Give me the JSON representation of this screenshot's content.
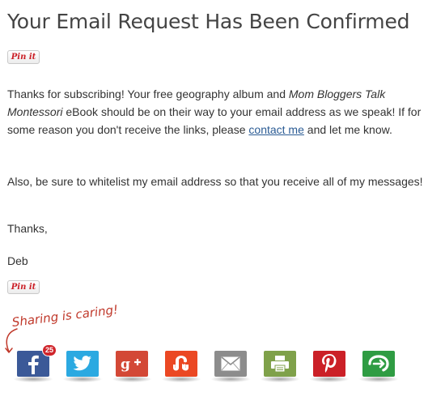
{
  "header": {
    "title": "Your Email Request Has Been Confirmed"
  },
  "pin_button": {
    "label": "Pin it"
  },
  "content": {
    "p1_before": "Thanks for subscribing! Your free geography album and ",
    "p1_italic": "Mom Bloggers Talk Montessori",
    "p1_middle": " eBook should be on their way to your email address as we speak! If for some reason you don't receive the links, please ",
    "p1_link": "contact me",
    "p1_after": " and let me know.",
    "p2": "Also, be sure to whitelist my email address so that you receive all of my messages!",
    "p3": "Thanks,",
    "p4": "Deb"
  },
  "sharing": {
    "caption": "Sharing is caring!",
    "caption_color": "#c0392b",
    "buttons": [
      {
        "icon": "facebook-icon",
        "color": "#3b5998",
        "badge": "25"
      },
      {
        "icon": "twitter-icon",
        "color": "#2ba9e1"
      },
      {
        "icon": "google-plus-icon",
        "color": "#d34836"
      },
      {
        "icon": "stumbleupon-icon",
        "color": "#eb4823"
      },
      {
        "icon": "email-icon",
        "color": "#8c8c8c"
      },
      {
        "icon": "print-icon",
        "color": "#7fa14a"
      },
      {
        "icon": "pinterest-icon",
        "color": "#cb2027"
      },
      {
        "icon": "sharethis-icon",
        "color": "#2f9c43"
      }
    ]
  }
}
